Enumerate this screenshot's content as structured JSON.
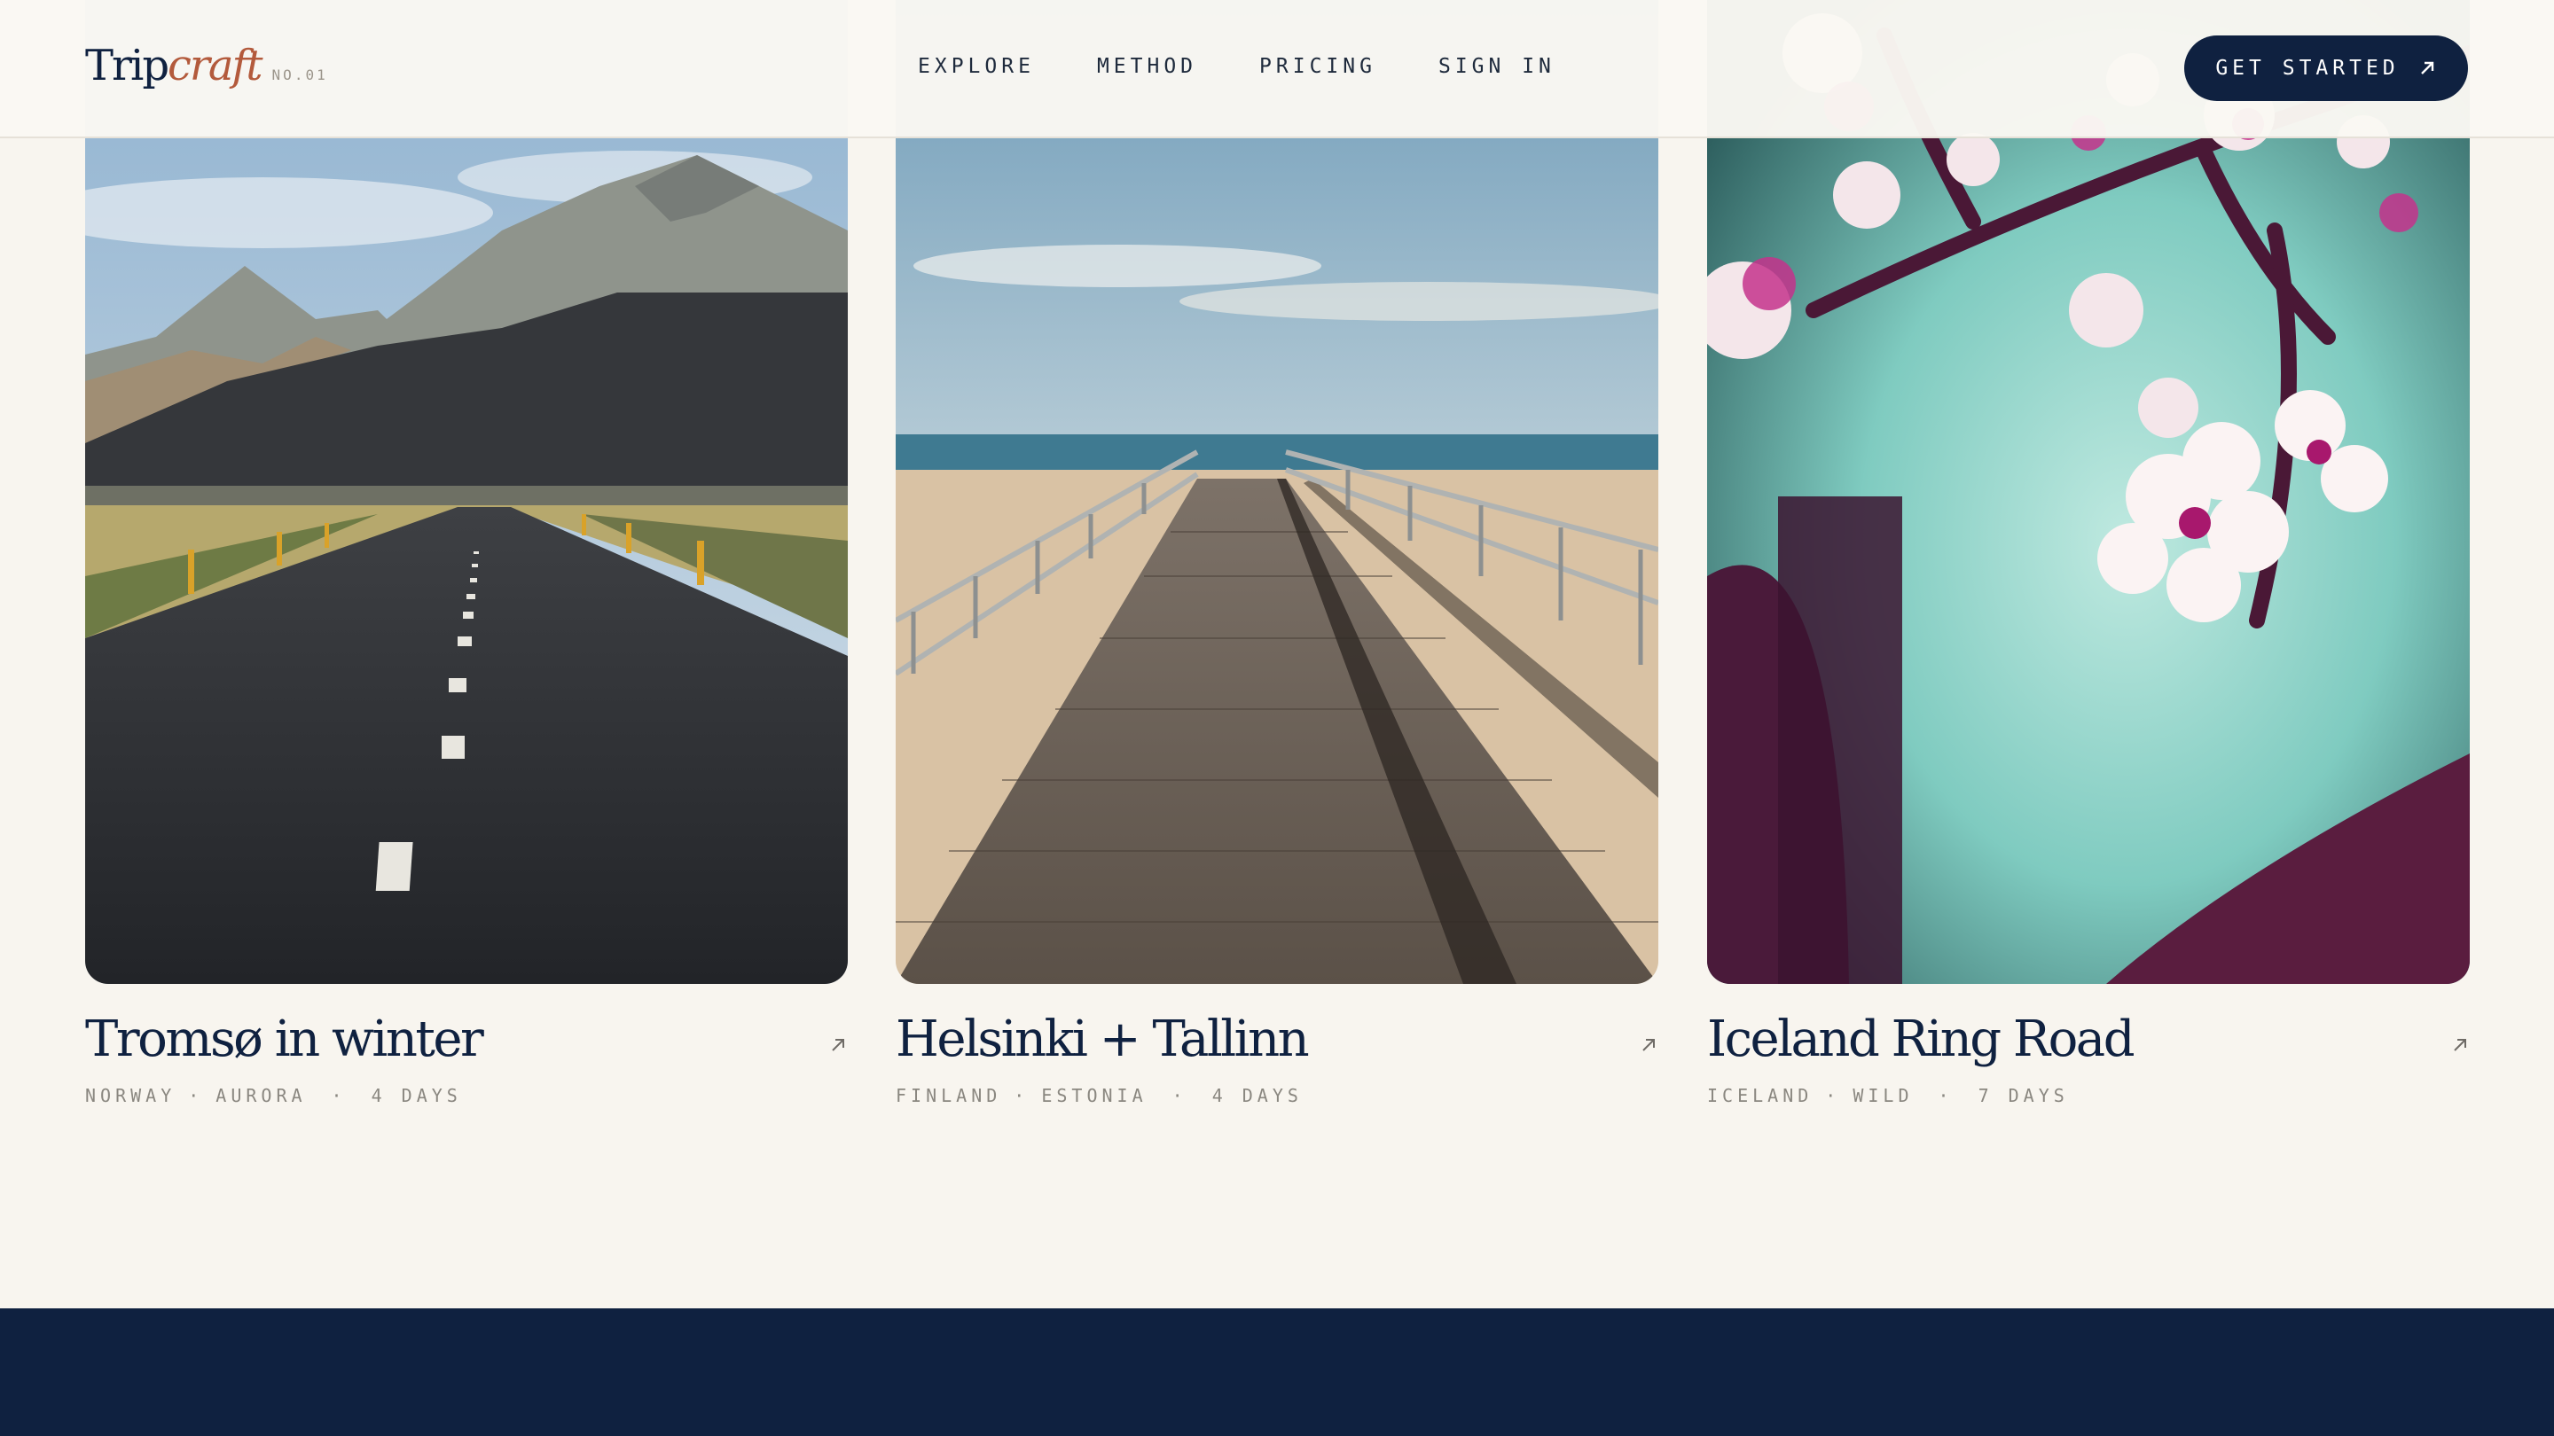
{
  "brand": {
    "name_plain": "Trip",
    "name_italic": "craft",
    "issue": "NO.01"
  },
  "nav": {
    "items": [
      {
        "label": "EXPLORE"
      },
      {
        "label": "METHOD"
      },
      {
        "label": "PRICING"
      },
      {
        "label": "SIGN IN"
      }
    ]
  },
  "cta": {
    "label": "GET STARTED",
    "icon": "arrow-up-right-icon"
  },
  "cards": [
    {
      "title": "Tromsø in winter",
      "tags": [
        "NORWAY",
        "AURORA"
      ],
      "duration": "4 DAYS",
      "image": "mountain-road-photo",
      "icon": "arrow-up-right-icon"
    },
    {
      "title": "Helsinki + Tallinn",
      "tags": [
        "FINLAND",
        "ESTONIA"
      ],
      "duration": "4 DAYS",
      "image": "boardwalk-beach-photo",
      "icon": "arrow-up-right-icon"
    },
    {
      "title": "Iceland Ring Road",
      "tags": [
        "ICELAND",
        "WILD"
      ],
      "duration": "7 DAYS",
      "image": "cherry-blossom-photo",
      "icon": "arrow-up-right-icon"
    }
  ],
  "colors": {
    "navy": "#0f2140",
    "terracotta": "#b35a3c",
    "background": "#f8f5ef",
    "muted": "#8a8780"
  }
}
